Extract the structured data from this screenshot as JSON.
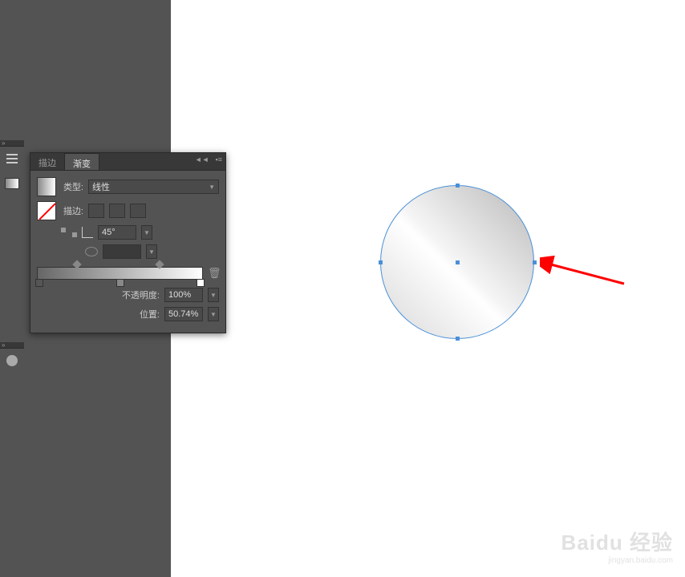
{
  "panel": {
    "tabs": {
      "stroke": "描边",
      "gradient": "渐变"
    },
    "type_label": "类型:",
    "type_value": "线性",
    "stroke_label": "描边:",
    "angle_value": "45°",
    "opacity_label": "不透明度:",
    "opacity_value": "100%",
    "location_label": "位置:",
    "location_value": "50.74%"
  },
  "dock": {
    "collapse_indicator": "»"
  },
  "watermark": {
    "main": "Baidu 经验",
    "sub": "jingyan.baidu.com"
  }
}
